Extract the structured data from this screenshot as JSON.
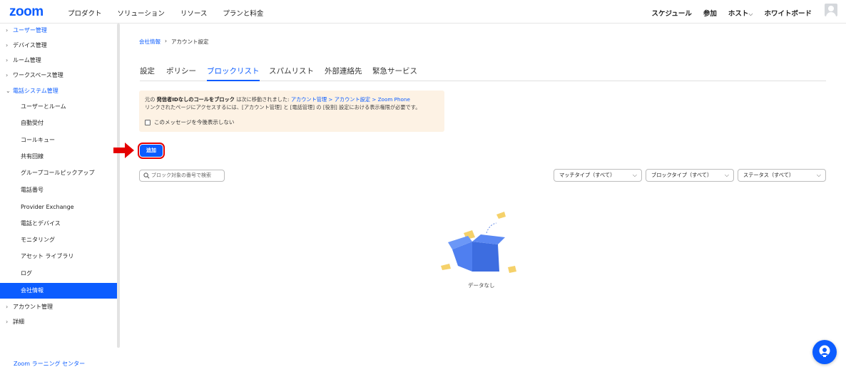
{
  "topbar": {
    "logo": "zoom",
    "nav_left": [
      "プロダクト",
      "ソリューション",
      "リソース",
      "プランと料金"
    ],
    "nav_right": [
      "スケジュール",
      "参加",
      "ホスト",
      "ホワイトボード"
    ],
    "host_chevron": "⌵"
  },
  "sidebar": {
    "items": [
      {
        "label": "ユーザー管理",
        "chevron": "›"
      },
      {
        "label": "デバイス管理",
        "chevron": "›"
      },
      {
        "label": "ルーム管理",
        "chevron": "›"
      },
      {
        "label": "ワークスペース管理",
        "chevron": "›"
      },
      {
        "label": "電話システム管理",
        "chevron": "⌄"
      },
      {
        "label": "ユーザーとルーム"
      },
      {
        "label": "自動受付"
      },
      {
        "label": "コールキュー"
      },
      {
        "label": "共有回線"
      },
      {
        "label": "グループコールピックアップ"
      },
      {
        "label": "電話番号"
      },
      {
        "label": "Provider Exchange"
      },
      {
        "label": "電話とデバイス"
      },
      {
        "label": "モニタリング"
      },
      {
        "label": "アセット ライブラリ"
      },
      {
        "label": "ログ"
      },
      {
        "label": "会社情報"
      },
      {
        "label": "アカウント管理",
        "chevron": "›"
      },
      {
        "label": "詳細",
        "chevron": "›"
      }
    ],
    "footer": "Zoom ラーニング センター"
  },
  "breadcrumb": {
    "parent": "会社情報",
    "separator": "›",
    "current": "アカウント設定"
  },
  "tabs": [
    "設定",
    "ポリシー",
    "ブロックリスト",
    "スパムリスト",
    "外部連絡先",
    "緊急サービス"
  ],
  "notice": {
    "prefix": "元の ",
    "bold": "発信者IDなしのコールをブロック",
    "middle": " は次に移動されました: ",
    "link": "アカウント管理 > アカウント設定 > Zoom Phone",
    "line2": "リンクされたページにアクセスするには、[アカウント管理] と [電話管理] の [役割] 設定における表示権限が必要です。",
    "checkbox_label": "このメッセージを今後表示しない"
  },
  "add_button": "追加",
  "search": {
    "placeholder": "ブロック対象の番号で検索"
  },
  "filters": [
    "マッチタイプ（すべて）",
    "ブロックタイプ（すべて）",
    "ステータス（すべて）"
  ],
  "empty": "データなし",
  "colors": {
    "accent": "#0b5cff",
    "notice_bg": "#fdf2e4",
    "highlight": "#e50000"
  }
}
